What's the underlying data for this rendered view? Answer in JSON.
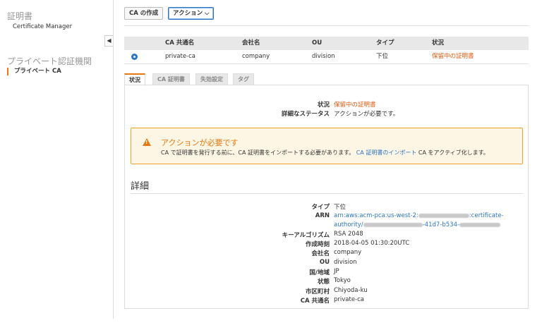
{
  "sidebar": {
    "cert_heading": "証明書",
    "cert_manager": "Certificate Manager",
    "private_ca_heading": "プライベート認証機関",
    "private_ca_item": "プライベート CA",
    "collapse_glyph": "◀"
  },
  "toolbar": {
    "create_ca": "CA の作成",
    "actions": "アクション ⌵"
  },
  "table": {
    "headers": [
      "CA 共通名",
      "会社名",
      "OU",
      "タイプ",
      "状況"
    ],
    "row": {
      "common_name": "private-ca",
      "company": "company",
      "ou": "division",
      "type": "下位",
      "status": "保留中の証明書"
    }
  },
  "tabs": [
    "状況",
    "CA 証明書",
    "失効設定",
    "タグ"
  ],
  "status_panel": {
    "status_label": "状況",
    "status_value": "保留中の証明書",
    "detail_label": "詳細なステータス",
    "detail_value": "アクションが必要です。"
  },
  "alert": {
    "title": "アクションが必要です",
    "msg_before": "CA で証明書を発行する前に、CA 証明書をインポートする必要があります。",
    "msg_link": "CA 証明書のインポート",
    "msg_after": " CA をアクティブ化します。",
    "icon": "warning-icon"
  },
  "details": {
    "title": "詳細",
    "type_label": "タイプ",
    "type_value": "下位",
    "arn_label": "ARN",
    "arn_line1_a": "arn:aws:acm-pca:us-west-2:",
    "arn_line1_b": ":certificate-",
    "arn_line2_a": "authority/",
    "arn_line2_b": "-41d7-b534-",
    "key_algo_label": "キーアルゴリズム",
    "key_algo_value": "RSA 2048",
    "created_label": "作成時刻",
    "created_value": "2018-04-05 01:30:20UTC",
    "company_label": "会社名",
    "company_value": "company",
    "ou_label": "OU",
    "ou_value": "division",
    "country_label": "国/地域",
    "country_value": "JP",
    "state_label": "状態",
    "state_value": "Tokyo",
    "city_label": "市区町村",
    "city_value": "Chiyoda-ku",
    "cn_label": "CA 共通名",
    "cn_value": "private-ca"
  },
  "colors": {
    "accent": "#e47911",
    "link": "#2a75c6",
    "status": "#e4590f"
  }
}
